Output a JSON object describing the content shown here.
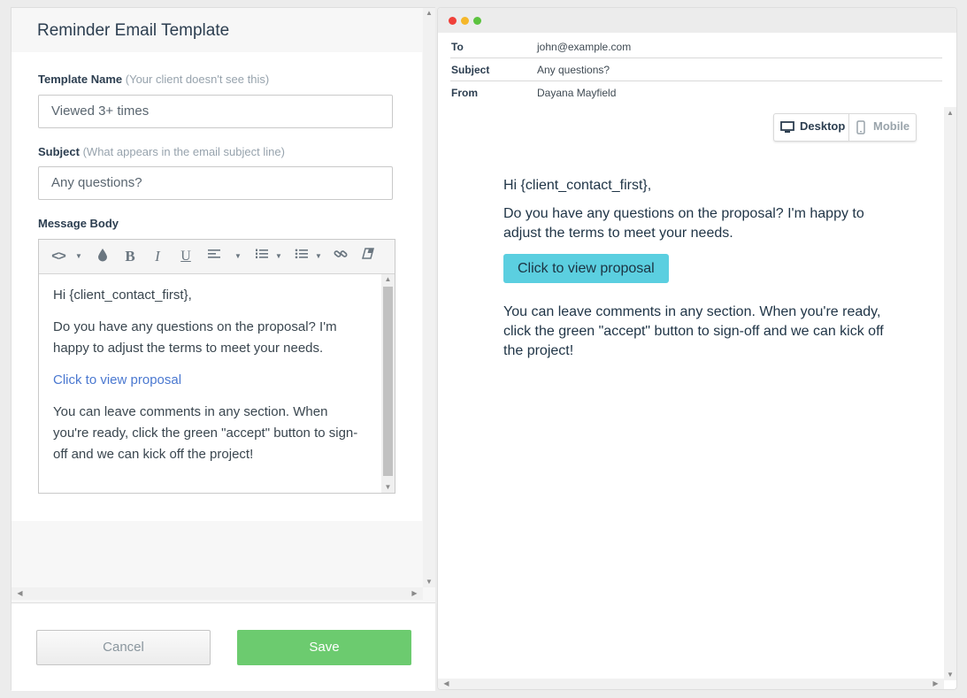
{
  "template_panel": {
    "title": "Reminder Email Template",
    "template_name": {
      "label": "Template Name",
      "hint": "(Your client doesn't see this)",
      "value": "Viewed 3+ times"
    },
    "subject": {
      "label": "Subject",
      "hint": "(What appears in the email subject line)",
      "value": "Any questions?"
    },
    "message_body": {
      "label": "Message Body",
      "toolbar": {
        "icons": [
          "code-icon",
          "color-drop-icon",
          "bold-icon",
          "italic-icon",
          "underline-icon",
          "align-icon",
          "ordered-list-icon",
          "unordered-list-icon",
          "link-icon",
          "clear-format-icon"
        ],
        "glyphs": {
          "code": "<>",
          "bold": "B",
          "italic": "I",
          "underline": "U"
        }
      },
      "greeting": "Hi {client_contact_first},",
      "paragraph1": "Do you have any questions on the proposal? I'm happy to adjust the terms to meet your needs.",
      "link": "Click to view proposal",
      "paragraph2": "You can leave comments in any section. When you're ready, click the green \"accept\" button to sign-off and we can kick off the project!"
    },
    "buttons": {
      "cancel": "Cancel",
      "save": "Save"
    }
  },
  "preview_panel": {
    "window_dots": {
      "red": "#f0413a",
      "yellow": "#f5b72a",
      "green": "#5cc33f"
    },
    "headers": {
      "to_label": "To",
      "to_value": "john@example.com",
      "subject_label": "Subject",
      "subject_value": "Any questions?",
      "from_label": "From",
      "from_value": "Dayana Mayfield"
    },
    "view_toggle": {
      "desktop": "Desktop",
      "mobile": "Mobile",
      "active": "desktop"
    },
    "email": {
      "greeting": "Hi {client_contact_first},",
      "paragraph1": "Do you have any questions on the proposal? I'm happy to adjust the terms to meet your needs.",
      "button": "Click to view proposal",
      "paragraph2": "You can leave comments in any section. When you're ready, click the green \"accept\" button to sign-off and we can kick off the project!"
    }
  },
  "colors": {
    "save_button": "#6ccb6f",
    "preview_button": "#5bcfe0",
    "link": "#4a78d0"
  }
}
